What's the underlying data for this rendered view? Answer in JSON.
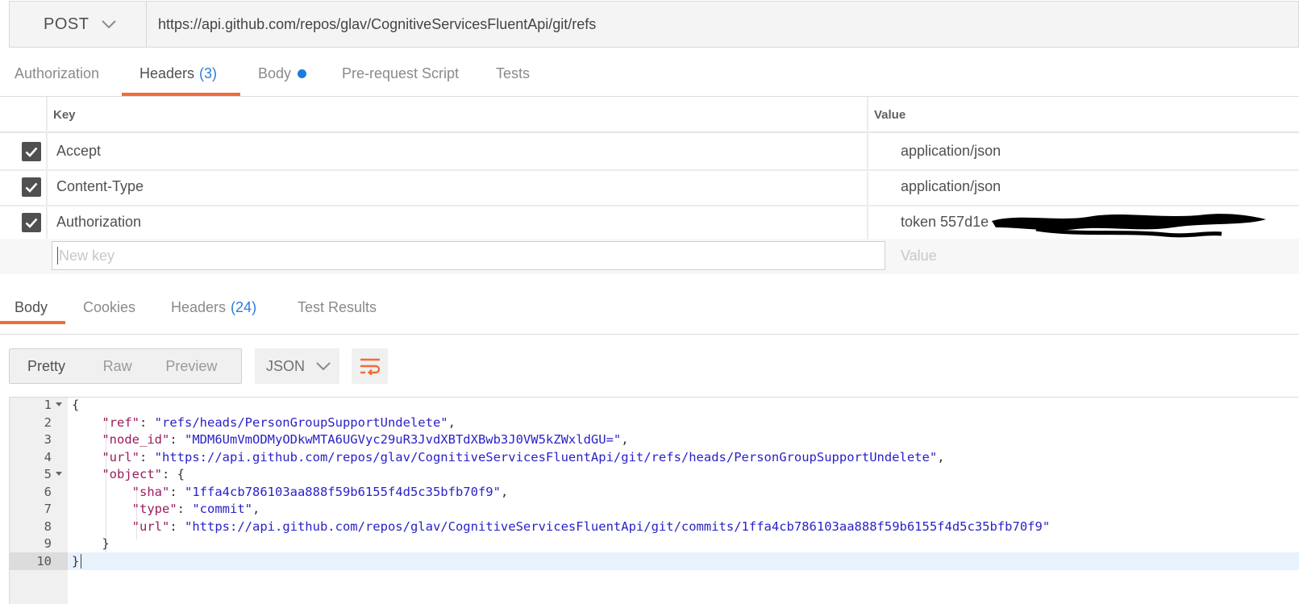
{
  "request": {
    "method": "POST",
    "url": "https://api.github.com/repos/glav/CognitiveServicesFluentApi/git/refs"
  },
  "request_tabs": [
    {
      "label": "Authorization"
    },
    {
      "label": "Headers",
      "count": "(3)"
    },
    {
      "label": "Body"
    },
    {
      "label": "Pre-request Script"
    },
    {
      "label": "Tests"
    }
  ],
  "headers_table": {
    "key_col": "Key",
    "value_col": "Value",
    "rows": [
      {
        "key": "Accept",
        "value": "application/json",
        "checked": true
      },
      {
        "key": "Content-Type",
        "value": "application/json",
        "checked": true
      },
      {
        "key": "Authorization",
        "value": "token 557d1e",
        "checked": true
      }
    ],
    "new_key_placeholder": "New key",
    "new_value_placeholder": "Value"
  },
  "response_tabs": [
    {
      "label": "Body"
    },
    {
      "label": "Cookies"
    },
    {
      "label": "Headers",
      "count": "(24)"
    },
    {
      "label": "Test Results"
    }
  ],
  "view_modes": [
    "Pretty",
    "Raw",
    "Preview"
  ],
  "format_select": "JSON",
  "code": {
    "line_numbers": [
      "1",
      "2",
      "3",
      "4",
      "5",
      "6",
      "7",
      "8",
      "9",
      "10"
    ],
    "lines": [
      [
        {
          "t": "p",
          "v": "{"
        }
      ],
      [
        {
          "t": "p",
          "v": "    "
        },
        {
          "t": "k",
          "v": "\"ref\""
        },
        {
          "t": "p",
          "v": ": "
        },
        {
          "t": "s",
          "v": "\"refs/heads/PersonGroupSupportUndelete\""
        },
        {
          "t": "p",
          "v": ","
        }
      ],
      [
        {
          "t": "p",
          "v": "    "
        },
        {
          "t": "k",
          "v": "\"node_id\""
        },
        {
          "t": "p",
          "v": ": "
        },
        {
          "t": "s",
          "v": "\"MDM6UmVmODMyODkwMTA6UGVyc29uR3JvdXBTdXBwb3J0VW5kZWxldGU=\""
        },
        {
          "t": "p",
          "v": ","
        }
      ],
      [
        {
          "t": "p",
          "v": "    "
        },
        {
          "t": "k",
          "v": "\"url\""
        },
        {
          "t": "p",
          "v": ": "
        },
        {
          "t": "s",
          "v": "\"https://api.github.com/repos/glav/CognitiveServicesFluentApi/git/refs/heads/PersonGroupSupportUndelete\""
        },
        {
          "t": "p",
          "v": ","
        }
      ],
      [
        {
          "t": "p",
          "v": "    "
        },
        {
          "t": "k",
          "v": "\"object\""
        },
        {
          "t": "p",
          "v": ": {"
        }
      ],
      [
        {
          "t": "p",
          "v": "        "
        },
        {
          "t": "k",
          "v": "\"sha\""
        },
        {
          "t": "p",
          "v": ": "
        },
        {
          "t": "s",
          "v": "\"1ffa4cb786103aa888f59b6155f4d5c35bfb70f9\""
        },
        {
          "t": "p",
          "v": ","
        }
      ],
      [
        {
          "t": "p",
          "v": "        "
        },
        {
          "t": "k",
          "v": "\"type\""
        },
        {
          "t": "p",
          "v": ": "
        },
        {
          "t": "s",
          "v": "\"commit\""
        },
        {
          "t": "p",
          "v": ","
        }
      ],
      [
        {
          "t": "p",
          "v": "        "
        },
        {
          "t": "k",
          "v": "\"url\""
        },
        {
          "t": "p",
          "v": ": "
        },
        {
          "t": "s",
          "v": "\"https://api.github.com/repos/glav/CognitiveServicesFluentApi/git/commits/1ffa4cb786103aa888f59b6155f4d5c35bfb70f9\""
        }
      ],
      [
        {
          "t": "p",
          "v": "    }"
        }
      ],
      [
        {
          "t": "p",
          "v": "}"
        }
      ]
    ]
  },
  "colors": {
    "accent": "#f26b3a",
    "count_blue": "#2d7be0",
    "json_key": "#9a1c5e",
    "json_string": "#2a22c8"
  }
}
